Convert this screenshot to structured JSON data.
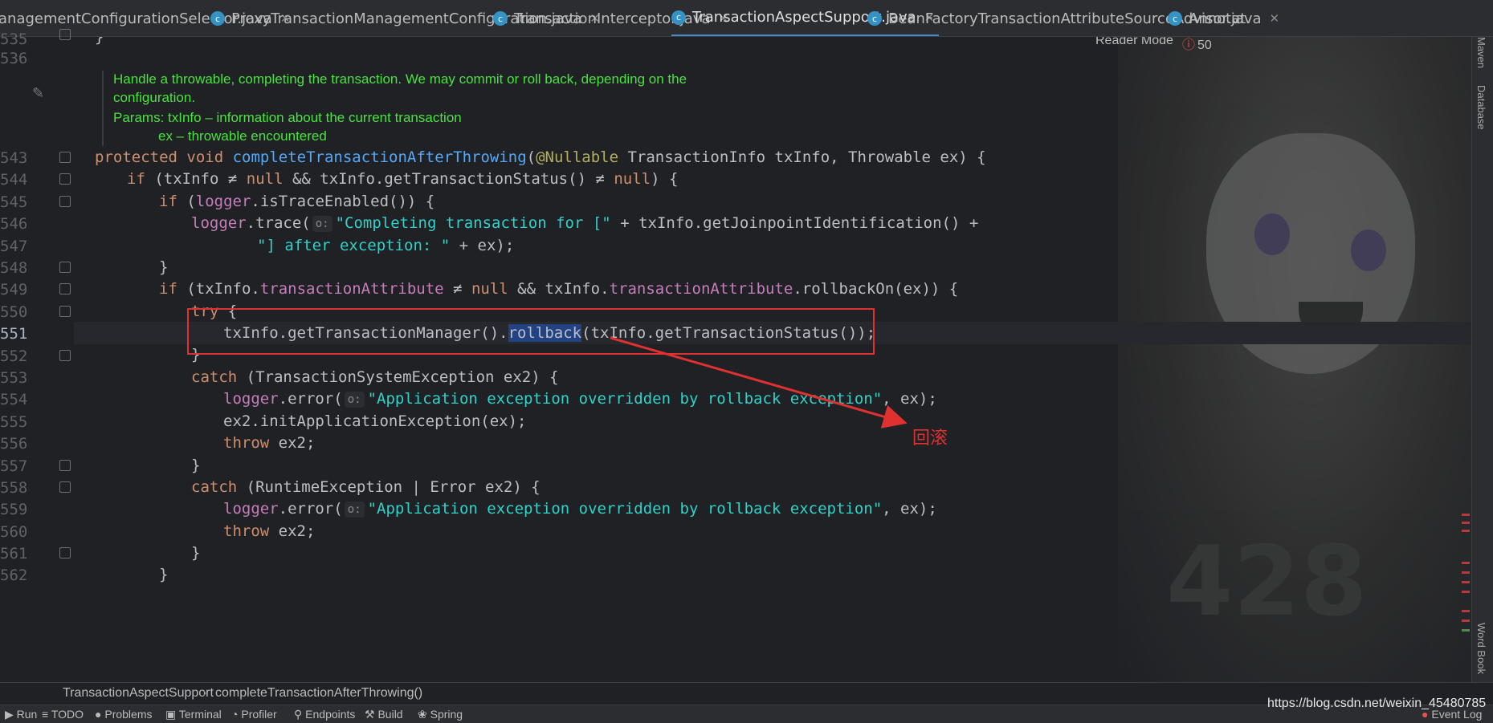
{
  "tabs": [
    {
      "label": "anagementConfigurationSelector.java",
      "active": false
    },
    {
      "label": "ProxyTransactionManagementConfiguration.java",
      "active": false
    },
    {
      "label": "TransactionInterceptor.java",
      "active": false
    },
    {
      "label": "TransactionAspectSupport.java",
      "active": true
    },
    {
      "label": "BeanFactoryTransactionAttributeSourceAdvisor.java",
      "active": false
    },
    {
      "label": "Annotat",
      "active": false
    }
  ],
  "tab_overflow_icon": "chevron-down-icon",
  "toolbar": {
    "reader_mode": "Reader Mode",
    "error_count": "50"
  },
  "right_tools": [
    "Maven",
    "Database",
    "Word Book"
  ],
  "line_numbers": [
    "535",
    "536",
    "",
    "",
    "",
    "",
    "543",
    "544",
    "545",
    "546",
    "547",
    "548",
    "549",
    "550",
    "551",
    "552",
    "553",
    "554",
    "555",
    "556",
    "557",
    "558",
    "559",
    "560",
    "561",
    "562"
  ],
  "doc_comment": {
    "line1": "Handle a throwable, completing the transaction. We may commit or roll back, depending on the",
    "line2": "configuration.",
    "params_label": "Params:",
    "param1": "txInfo – information about the current transaction",
    "param2": "ex – throwable encountered"
  },
  "code": {
    "l535": "}",
    "l543": {
      "kw1": "protected void ",
      "fn": "completeTransactionAfterThrowing",
      "p1": "(",
      "ann": "@Nullable",
      "rest": " TransactionInfo txInfo, Throwable ex) {"
    },
    "l544": {
      "kw": "if",
      "a": " (txInfo ",
      "ne": "≠",
      "b": " ",
      "null1": "null",
      "c": " && txInfo.getTransactionStatus() ",
      "ne2": "≠",
      "d": " ",
      "null2": "null",
      "e": ") {"
    },
    "l545": {
      "kw": "if",
      "a": " (",
      "fd": "logger",
      "b": ".isTraceEnabled()) {"
    },
    "l546": {
      "fd": "logger",
      "a": ".trace(",
      "hint": "o:",
      "str": "\"Completing transaction for [\"",
      "b": " + txInfo.getJoinpointIdentification() +"
    },
    "l547": {
      "str": "\"] after exception: \"",
      "b": " + ex);"
    },
    "l548": "}",
    "l549": {
      "kw": "if",
      "a": " (txInfo.",
      "fd1": "transactionAttribute",
      "b": " ≠ ",
      "null": "null",
      "c": " && txInfo.",
      "fd2": "transactionAttribute",
      "d": ".rollbackOn(ex)) {"
    },
    "l550": {
      "kw": "try",
      "a": " {"
    },
    "l551": {
      "a": "txInfo.getTransactionManager().",
      "sel": "rollback",
      "b": "(txInfo.getTransactionStatus());"
    },
    "l552": "}",
    "l553": {
      "kw": "catch",
      "a": " (TransactionSystemException ex2) {"
    },
    "l554": {
      "fd": "logger",
      "a": ".error(",
      "hint": "o:",
      "str": "\"Application exception overridden by rollback exception\"",
      "b": ", ex);"
    },
    "l555": "ex2.initApplicationException(ex);",
    "l556": {
      "kw": "throw",
      "a": " ex2;"
    },
    "l557": "}",
    "l558": {
      "kw": "catch",
      "a": " (RuntimeException | Error ex2) {"
    },
    "l559": {
      "fd": "logger",
      "a": ".error(",
      "hint": "o:",
      "str": "\"Application exception overridden by rollback exception\"",
      "b": ", ex);"
    },
    "l560": {
      "kw": "throw",
      "a": " ex2;"
    },
    "l561": "}",
    "l562": "}"
  },
  "annotation_label": "回滚",
  "breadcrumb": {
    "class_name": "TransactionAspectSupport",
    "sep": "›",
    "method_name": "completeTransactionAfterThrowing()"
  },
  "status_items": [
    "Run",
    "TODO",
    "Problems",
    "Terminal",
    "Profiler",
    "Endpoints",
    "Build",
    "Spring",
    "Event Log"
  ],
  "watermark": "https://blog.csdn.net/weixin_45480785"
}
